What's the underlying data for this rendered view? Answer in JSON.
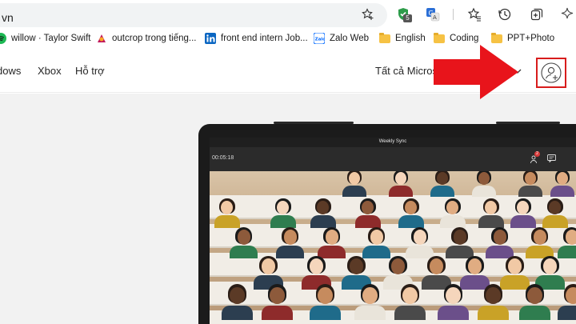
{
  "browser": {
    "address_text": "vn",
    "icons": {
      "favorite_star": "star-plus-icon",
      "extension_shield": "shield-extension-icon",
      "extension_shield_badge": "5",
      "extension_translate": "translate-icon",
      "favorites": "favorites-icon",
      "history": "history-icon",
      "collections": "collections-icon",
      "copilot": "sparkle-icon"
    }
  },
  "bookmarks": [
    {
      "label": "willow · Taylor Swift",
      "icon": "spotify-icon"
    },
    {
      "label": "outcrop trong tiếng...",
      "icon": "dictionary-icon"
    },
    {
      "label": "front end intern Job...",
      "icon": "linkedin-icon"
    },
    {
      "label": "Zalo Web",
      "icon": "zalo-icon"
    },
    {
      "label": "English",
      "icon": "folder-icon"
    },
    {
      "label": "Coding",
      "icon": "folder-icon"
    },
    {
      "label": "PPT+Photo",
      "icon": "folder-icon"
    }
  ],
  "site_nav": {
    "links": [
      "dows",
      "Xbox",
      "Hỗ trợ",
      "Tất cả Microso"
    ],
    "account_icon": "account-sign-in-icon"
  },
  "annotation": {
    "arrow_color": "#e8141b",
    "highlight_color": "#d81c1c"
  },
  "meeting": {
    "title": "Weekly Sync",
    "elapsed": "00:05:18",
    "participants_badge": "2"
  },
  "colors": {
    "address_bg": "#f1f3f4",
    "hero_bg": "#f2f2f2",
    "laptop_bezel": "#1b1b1b"
  }
}
